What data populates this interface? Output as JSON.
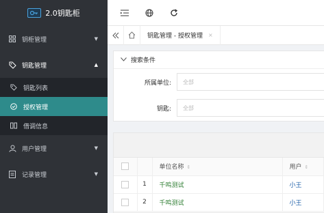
{
  "app": {
    "title": "2.0钥匙柜"
  },
  "sidebar": {
    "items": [
      {
        "label": "钥柜管理",
        "icon": "grid-icon",
        "arrow": "▼"
      },
      {
        "label": "钥匙管理",
        "icon": "tag-icon",
        "arrow": "▲"
      },
      {
        "label": "用户管理",
        "icon": "user-icon",
        "arrow": "▼"
      },
      {
        "label": "记录管理",
        "icon": "document-icon",
        "arrow": "▼"
      }
    ],
    "sub_items": [
      {
        "label": "钥匙列表",
        "icon": "tag-icon",
        "active": false
      },
      {
        "label": "授权管理",
        "icon": "check-circle-icon",
        "active": true
      },
      {
        "label": "借调信息",
        "icon": "columns-icon",
        "active": false
      }
    ]
  },
  "tabs": {
    "active_label": "钥匙管理 - 授权管理",
    "close_glyph": "×"
  },
  "search": {
    "title": "搜索条件",
    "fields": [
      {
        "label": "所属单位:",
        "placeholder": "全部"
      },
      {
        "label": "钥匙:",
        "placeholder": "全部"
      }
    ]
  },
  "table": {
    "columns": [
      "单位名称",
      "用户"
    ],
    "sort_glyph": "⇕",
    "rows": [
      {
        "index": "1",
        "unit": "千鸣测试",
        "user": "小王"
      },
      {
        "index": "2",
        "unit": "千鸣测试",
        "user": "小王"
      }
    ]
  },
  "colors": {
    "sidebar_bg": "#2f3237",
    "active_item": "#2e8b8b",
    "unit_text": "#2e7d32",
    "user_text": "#1e5fa8"
  }
}
